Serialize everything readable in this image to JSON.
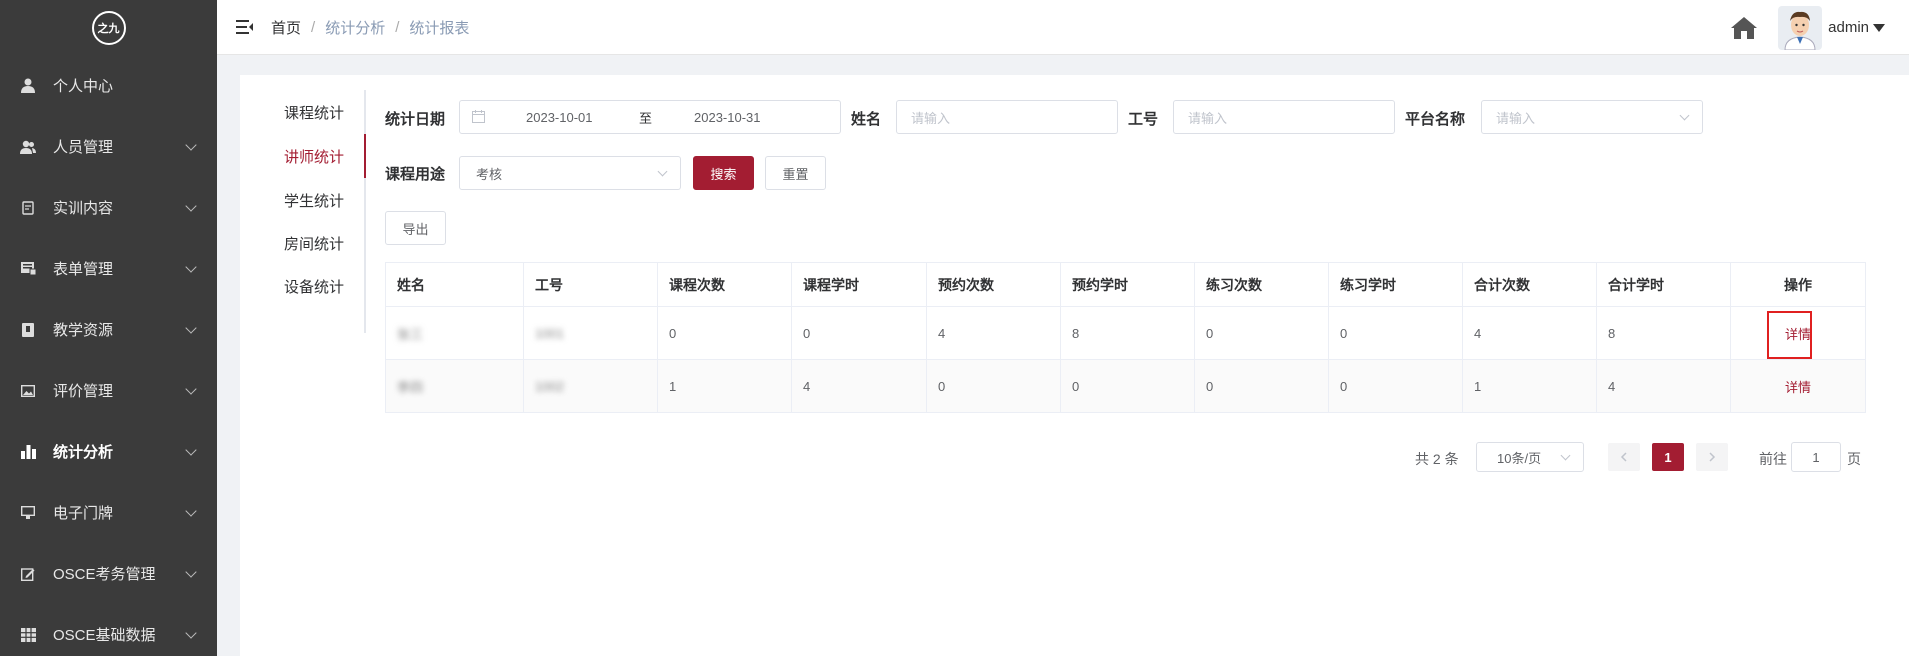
{
  "logo": {
    "text": "之九"
  },
  "sidebar": {
    "items": [
      {
        "label": "个人中心",
        "icon": "user-icon",
        "has_children": false
      },
      {
        "label": "人员管理",
        "icon": "users-icon",
        "has_children": true
      },
      {
        "label": "实训内容",
        "icon": "clipboard-icon",
        "has_children": true
      },
      {
        "label": "表单管理",
        "icon": "form-icon",
        "has_children": true
      },
      {
        "label": "教学资源",
        "icon": "book-icon",
        "has_children": true
      },
      {
        "label": "评价管理",
        "icon": "image-icon",
        "has_children": true
      },
      {
        "label": "统计分析",
        "icon": "bar-chart-icon",
        "has_children": true,
        "active": true
      },
      {
        "label": "电子门牌",
        "icon": "monitor-icon",
        "has_children": true
      },
      {
        "label": "OSCE考务管理",
        "icon": "edit-icon",
        "has_children": true
      },
      {
        "label": "OSCE基础数据",
        "icon": "grid-icon",
        "has_children": true
      }
    ]
  },
  "header": {
    "breadcrumb": {
      "home": "首页",
      "level1": "统计分析",
      "level2": "统计报表",
      "separator": "/"
    },
    "user_name": "admin"
  },
  "subnav": {
    "items": [
      "课程统计",
      "讲师统计",
      "学生统计",
      "房间统计",
      "设备统计"
    ],
    "active_index": 1
  },
  "filters": {
    "date_label": "统计日期",
    "date_start": "2023-10-01",
    "date_to": "至",
    "date_end": "2023-10-31",
    "name_label": "姓名",
    "name_placeholder": "请输入",
    "id_label": "工号",
    "id_placeholder": "请输入",
    "platform_label": "平台名称",
    "platform_placeholder": "请输入",
    "purpose_label": "课程用途",
    "purpose_value": "考核",
    "search_label": "搜索",
    "reset_label": "重置",
    "export_label": "导出"
  },
  "table": {
    "columns": [
      "姓名",
      "工号",
      "课程次数",
      "课程学时",
      "预约次数",
      "预约学时",
      "练习次数",
      "练习学时",
      "合计次数",
      "合计学时",
      "操作"
    ],
    "rows": [
      {
        "name": "张三",
        "id": "1001",
        "values": [
          "0",
          "0",
          "4",
          "8",
          "0",
          "0",
          "4",
          "8"
        ],
        "action": "详情"
      },
      {
        "name": "李四",
        "id": "1002",
        "values": [
          "1",
          "4",
          "0",
          "0",
          "0",
          "0",
          "1",
          "4"
        ],
        "action": "详情"
      }
    ]
  },
  "pagination": {
    "total_text": "共 2 条",
    "page_size": "10条/页",
    "current_page": "1",
    "goto_prefix": "前往",
    "goto_value": "1",
    "goto_suffix": "页"
  },
  "colors": {
    "accent": "#a31d32",
    "sidebar_bg": "#3b3b3b",
    "highlight": "#e02020"
  }
}
